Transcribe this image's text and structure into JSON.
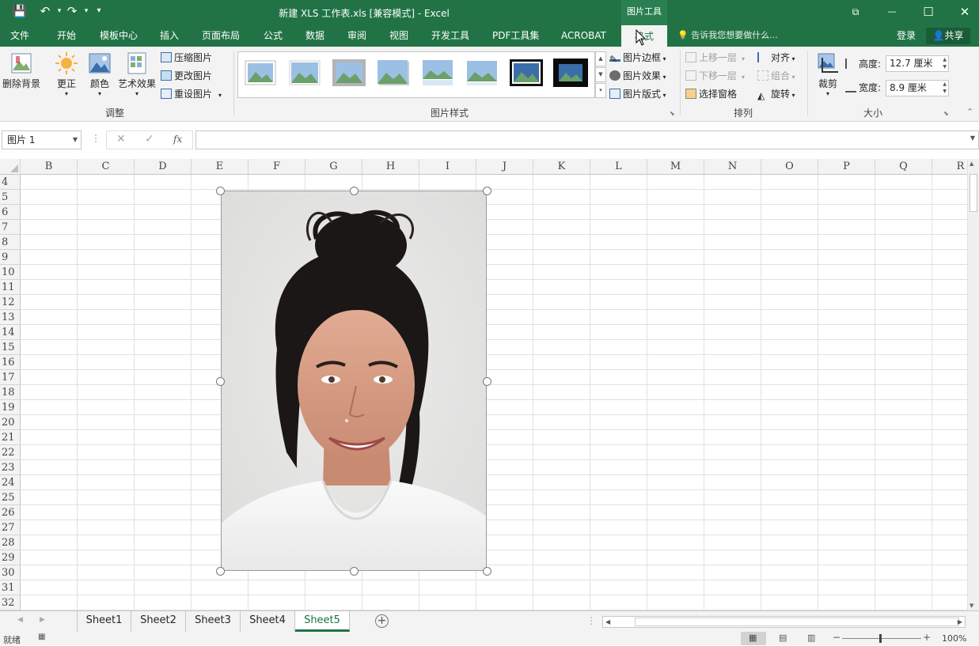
{
  "title_bar": {
    "title": "新建 XLS 工作表.xls  [兼容模式] - Excel",
    "context_label": "图片工具",
    "qat": {
      "save": "💾",
      "undo": "↶",
      "redo": "↷",
      "customize": "▾"
    },
    "window": {
      "ribbon_options": "⧉",
      "minimize": "—",
      "maximize": "☐",
      "close": "✕"
    }
  },
  "menu": {
    "tabs": [
      "文件",
      "开始",
      "模板中心",
      "插入",
      "页面布局",
      "公式",
      "数据",
      "审阅",
      "视图",
      "开发工具",
      "PDF工具集",
      "ACROBAT",
      "格式"
    ],
    "active_tab": "格式",
    "tell_me": "告诉我您想要做什么...",
    "login": "登录",
    "share": "共享"
  },
  "ribbon": {
    "adjust": {
      "remove_bg": "删除背景",
      "corrections": "更正",
      "color": "颜色",
      "artistic": "艺术效果",
      "compress": "压缩图片",
      "change": "更改图片",
      "reset": "重设图片",
      "group_label": "调整"
    },
    "styles": {
      "border": "图片边框",
      "effects": "图片效果",
      "layout": "图片版式",
      "group_label": "图片样式"
    },
    "arrange": {
      "bring_forward": "上移一层",
      "send_backward": "下移一层",
      "selection_pane": "选择窗格",
      "align": "对齐",
      "group": "组合",
      "rotate": "旋转",
      "group_label": "排列"
    },
    "size": {
      "crop": "裁剪",
      "height_label": "高度:",
      "height_value": "12.7 厘米",
      "width_label": "宽度:",
      "width_value": "8.9 厘米",
      "group_label": "大小"
    }
  },
  "formula_bar": {
    "name_box": "图片 1",
    "fx": "fx",
    "cancel": "✕",
    "enter": "✓",
    "formula": ""
  },
  "grid": {
    "columns": [
      "B",
      "C",
      "D",
      "E",
      "F",
      "G",
      "H",
      "I",
      "J",
      "K",
      "L",
      "M",
      "N",
      "O",
      "P",
      "Q",
      "R"
    ],
    "rows": [
      "4",
      "5",
      "6",
      "7",
      "8",
      "9",
      "10",
      "11",
      "12",
      "13",
      "14",
      "15",
      "16",
      "17",
      "18",
      "19",
      "20",
      "21",
      "22",
      "23",
      "24",
      "25",
      "26",
      "27",
      "28",
      "29",
      "30",
      "31",
      "32"
    ]
  },
  "sheets": {
    "tabs": [
      "Sheet1",
      "Sheet2",
      "Sheet3",
      "Sheet4",
      "Sheet5"
    ],
    "active": "Sheet5",
    "add": "+"
  },
  "status": {
    "ready": "就绪",
    "zoom": "100%"
  },
  "colors": {
    "accent": "#217346",
    "ribbon_bg": "#f3f3f3",
    "photo_bg": "#e4e4e3",
    "hair": "#1b1716",
    "skin": "#d9a088",
    "shirt": "#f4f4f4"
  }
}
